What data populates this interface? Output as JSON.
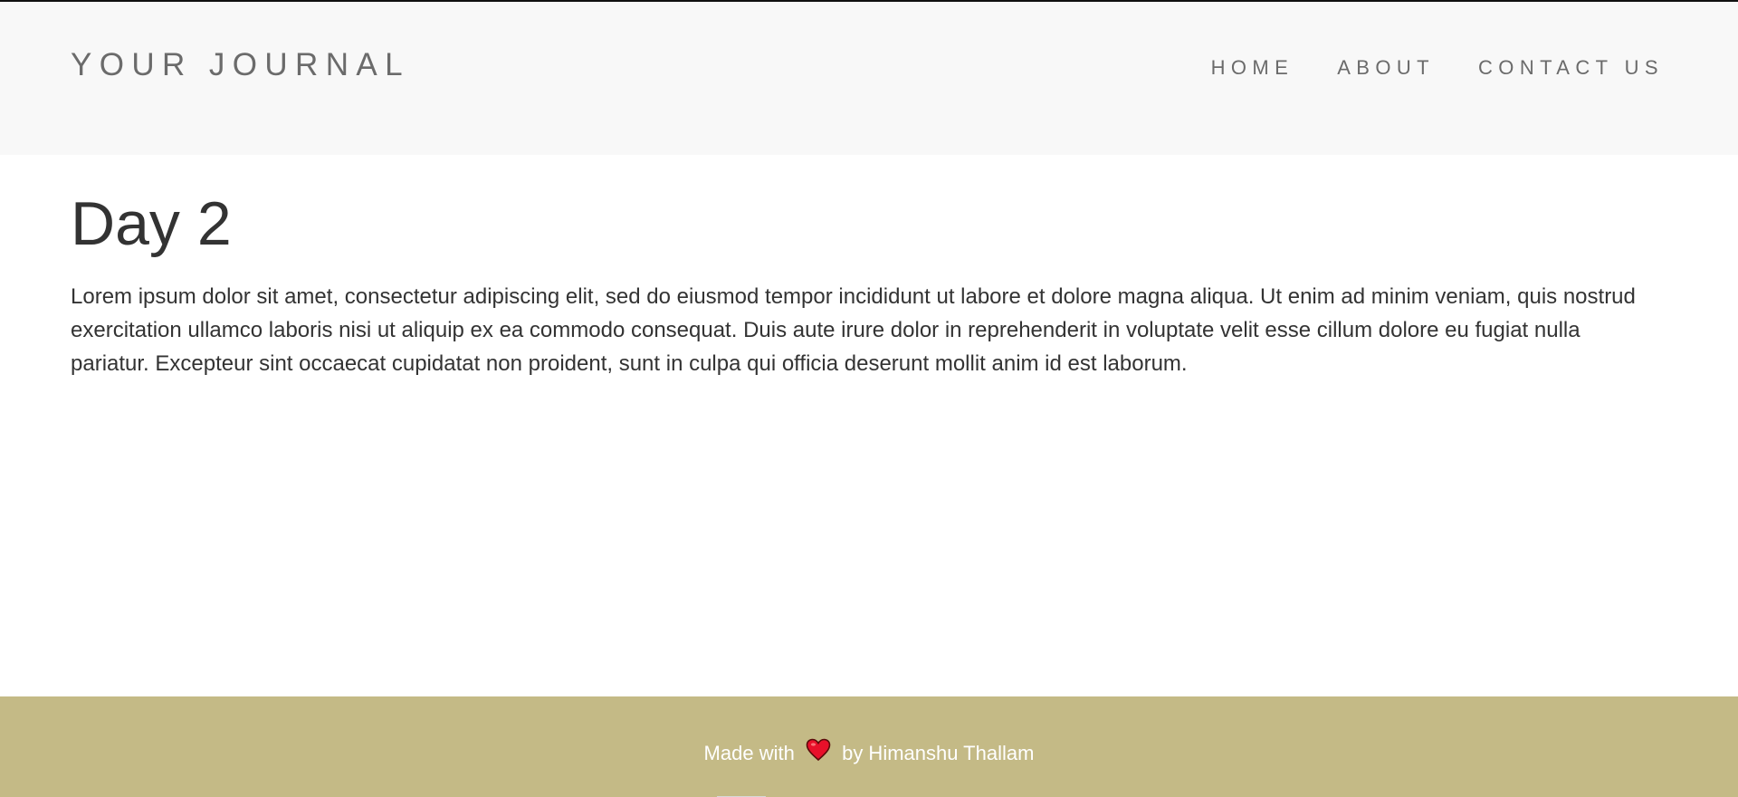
{
  "header": {
    "brand": "YOUR JOURNAL",
    "nav": {
      "home": "HOME",
      "about": "ABOUT",
      "contact": "CONTACT US"
    }
  },
  "post": {
    "title": "Day 2",
    "body": "Lorem ipsum dolor sit amet, consectetur adipiscing elit, sed do eiusmod tempor incididunt ut labore et dolore magna aliqua. Ut enim ad minim veniam, quis nostrud exercitation ullamco laboris nisi ut aliquip ex ea commodo consequat. Duis aute irure dolor in reprehenderit in voluptate velit esse cillum dolore eu fugiat nulla pariatur. Excepteur sint occaecat cupidatat non proident, sunt in culpa qui officia deserunt mollit anim id est laborum."
  },
  "footer": {
    "prefix": "Made with",
    "icon": "heart-icon",
    "suffix": "by Himanshu Thallam"
  },
  "colors": {
    "header_bg": "#f8f8f8",
    "nav_text": "#6b6b6b",
    "body_text": "#333333",
    "footer_bg": "#c4ba86",
    "heart": "#e8102a"
  }
}
